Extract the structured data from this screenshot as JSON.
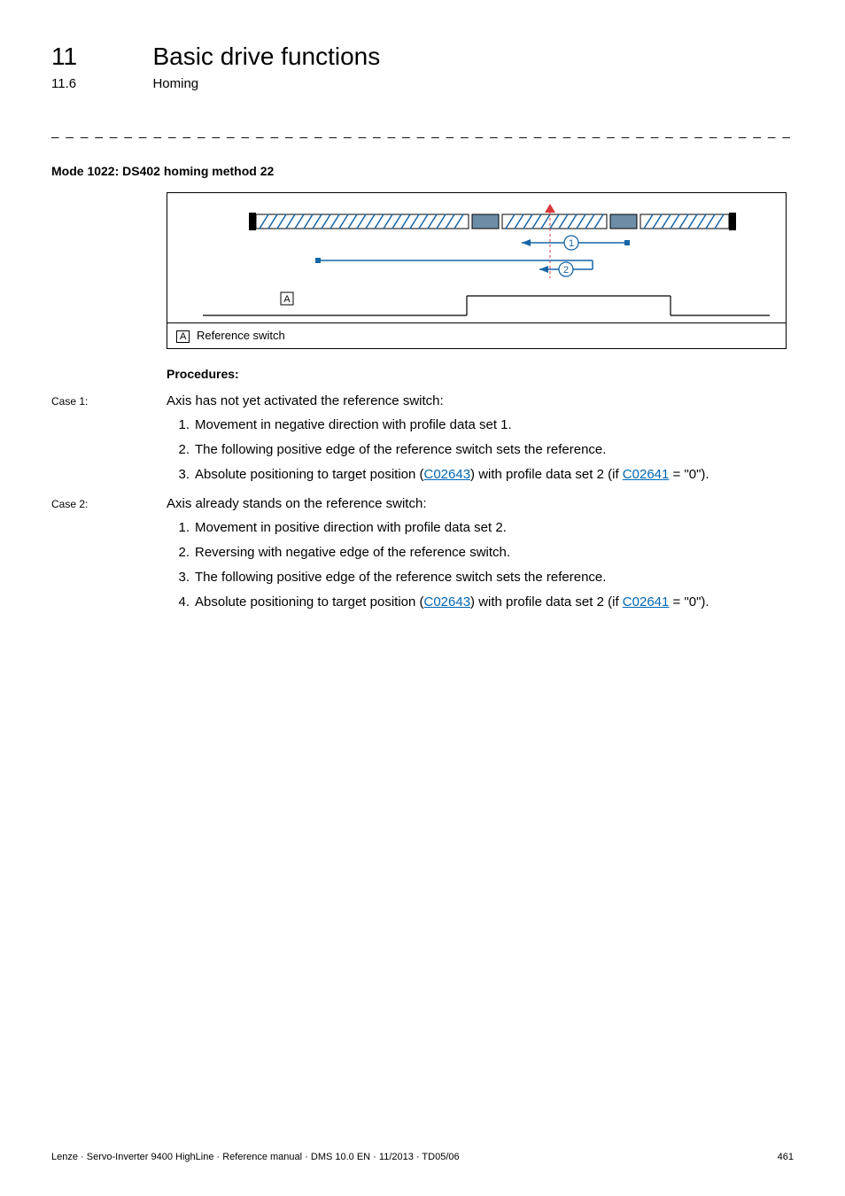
{
  "chapter": {
    "num": "11",
    "title": "Basic drive functions"
  },
  "section": {
    "num": "11.6",
    "title": "Homing"
  },
  "dash": "_ _ _ _ _ _ _ _ _ _ _ _ _ _ _ _ _ _ _ _ _ _ _ _ _ _ _ _ _ _ _ _ _ _ _ _ _ _ _ _ _ _ _ _ _ _ _ _ _ _ _ _ _ _ _ _ _ _ _ _ _ _ _ _",
  "modeHeading": "Mode 1022: DS402 homing method 22",
  "figureLegend": {
    "tag": "A",
    "text": "Reference switch"
  },
  "proceduresLabel": "Procedures:",
  "cases": [
    {
      "label": "Case 1:",
      "intro": "Axis has not yet activated the reference switch:",
      "items": [
        {
          "n": "1.",
          "parts": [
            {
              "t": "Movement in negative direction with profile data set 1."
            }
          ]
        },
        {
          "n": "2.",
          "parts": [
            {
              "t": "The following positive edge of the reference switch sets the reference."
            }
          ]
        },
        {
          "n": "3.",
          "parts": [
            {
              "t": "Absolute positioning to target position ("
            },
            {
              "t": "C02643",
              "link": true
            },
            {
              "t": ") with profile data set 2 (if "
            },
            {
              "t": "C02641",
              "link": true
            },
            {
              "t": " = \"0\")."
            }
          ]
        }
      ]
    },
    {
      "label": "Case 2:",
      "intro": "Axis already stands on the reference switch:",
      "items": [
        {
          "n": "1.",
          "parts": [
            {
              "t": "Movement in positive direction with profile data set 2."
            }
          ]
        },
        {
          "n": "2.",
          "parts": [
            {
              "t": "Reversing with negative edge of the reference switch."
            }
          ]
        },
        {
          "n": "3.",
          "parts": [
            {
              "t": "The following positive edge of the reference switch sets the reference."
            }
          ]
        },
        {
          "n": "4.",
          "parts": [
            {
              "t": "Absolute positioning to target position ("
            },
            {
              "t": "C02643",
              "link": true
            },
            {
              "t": ") with profile data set 2 (if "
            },
            {
              "t": "C02641",
              "link": true
            },
            {
              "t": " = \"0\")."
            }
          ]
        }
      ]
    }
  ],
  "footer": {
    "left": "Lenze · Servo-Inverter 9400 HighLine · Reference manual · DMS 10.0 EN · 11/2013 · TD05/06",
    "right": "461"
  }
}
